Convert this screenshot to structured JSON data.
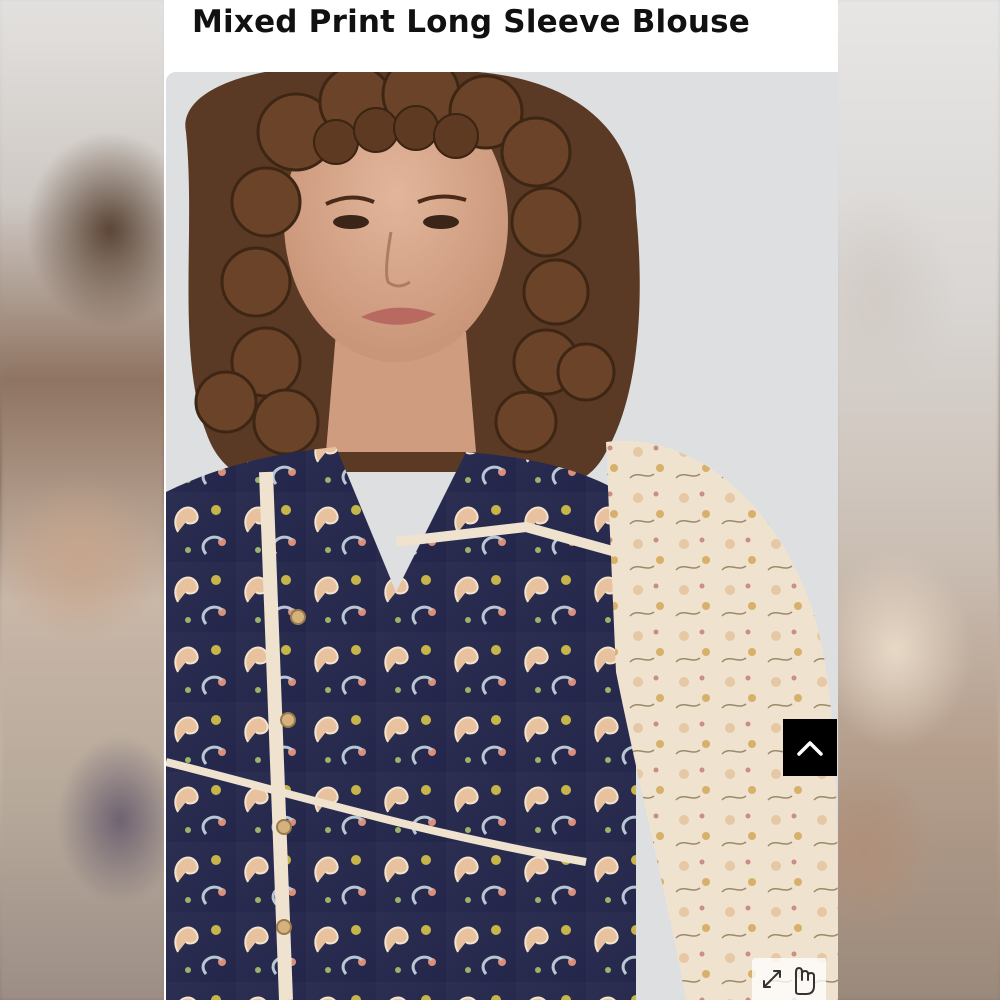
{
  "product": {
    "title": "Mixed Print Long Sleeve Blouse"
  },
  "icons": {
    "scroll_top": "chevron-up-icon",
    "zoom_arrows": "expand-arrows-icon",
    "zoom_hand": "pointer-hand-icon"
  },
  "colors": {
    "title_text": "#111111",
    "scroll_button_bg": "#000000",
    "page_bg": "#ffffff"
  }
}
